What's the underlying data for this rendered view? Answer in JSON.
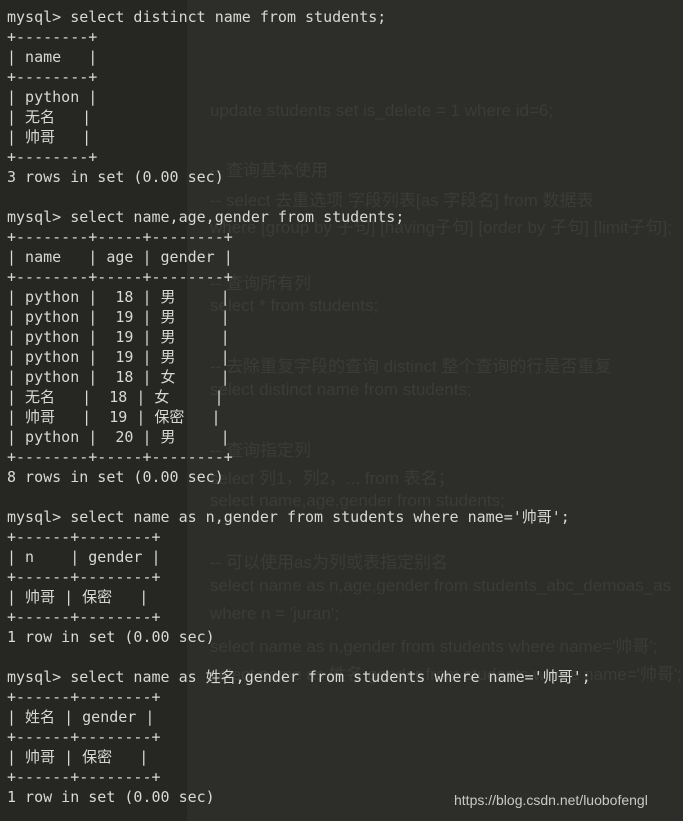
{
  "terminal": {
    "lines": [
      "mysql> select distinct name from students;",
      "+--------+",
      "| name   |",
      "+--------+",
      "| python |",
      "| 无名   |",
      "| 帅哥   |",
      "+--------+",
      "3 rows in set (0.00 sec)",
      "",
      "mysql> select name,age,gender from students;",
      "+--------+-----+--------+",
      "| name   | age | gender |",
      "+--------+-----+--------+",
      "| python |  18 | 男     |",
      "| python |  19 | 男     |",
      "| python |  19 | 男     |",
      "| python |  19 | 男     |",
      "| python |  18 | 女     |",
      "| 无名   |  18 | 女     |",
      "| 帅哥   |  19 | 保密   |",
      "| python |  20 | 男     |",
      "+--------+-----+--------+",
      "8 rows in set (0.00 sec)",
      "",
      "mysql> select name as n,gender from students where name='帅哥';",
      "+------+--------+",
      "| n    | gender |",
      "+------+--------+",
      "| 帅哥 | 保密   |",
      "+------+--------+",
      "1 row in set (0.00 sec)",
      "",
      "mysql> select name as 姓名,gender from students where name='帅哥';",
      "+------+--------+",
      "| 姓名 | gender |",
      "+------+--------+",
      "| 帅哥 | 保密   |",
      "+------+--------+",
      "1 row in set (0.00 sec)"
    ]
  },
  "background_editor": {
    "lines": [
      "update students set is_delete = 1 where id=6;",
      "-- 查询基本使用",
      "-- select 去重选项 字段列表[as 字段名] from 数据表",
      "where [group by 子句] [having子句] [order by 子句] [limit子句];",
      "-- 查询所有列",
      "select * from students;",
      "-- 去除重复字段的查询  distinct 整个查询的行是否重复",
      "select distinct name from students;",
      "-- 查询指定列",
      "select 列1，列2，... from 表名；",
      "select name,age,gender from students;",
      "-- 可以使用as为列或表指定别名",
      "select name as n,age,gender from students_abc_demoas_as",
      "where n = 'juran';",
      "select name as n,gender from students where name='帅哥';",
      "select name as 姓名,gender from students where name='帅哥';"
    ]
  },
  "watermark": "https://blog.csdn.net/luobofengl",
  "colors": {
    "background": "#2d2d29",
    "terminal_text": "#d8d8d4"
  }
}
